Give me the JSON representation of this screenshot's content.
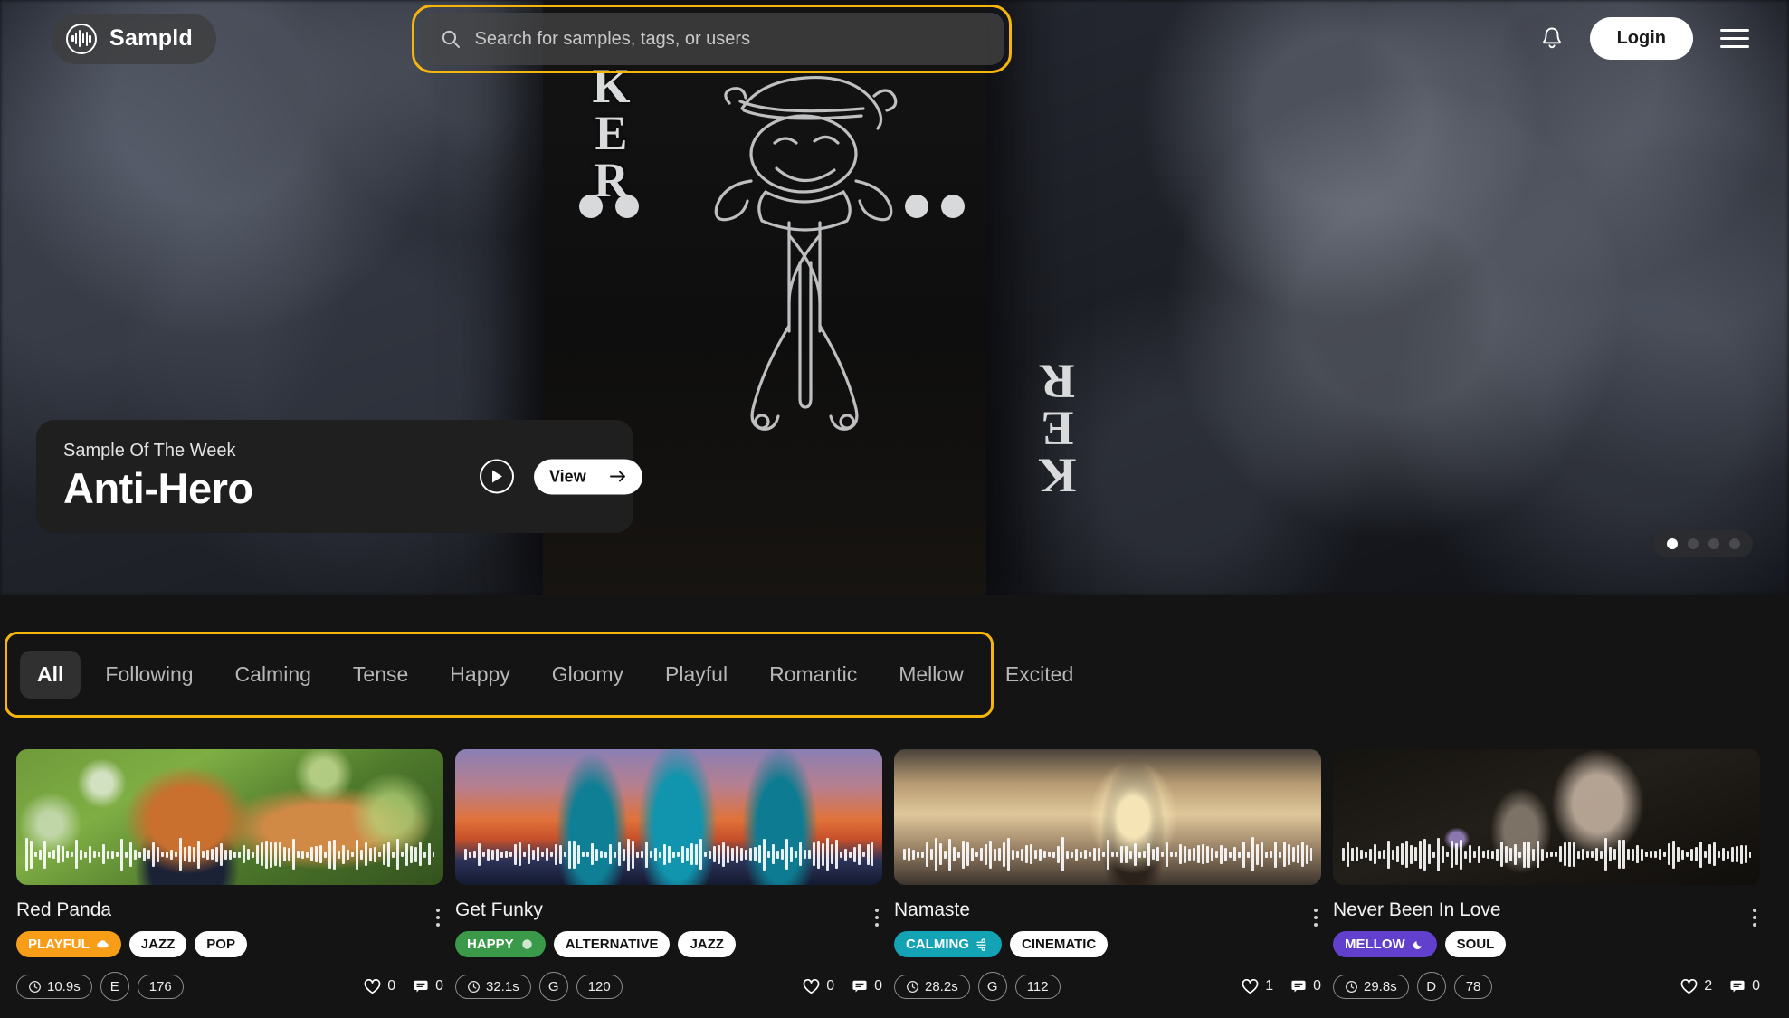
{
  "brand": {
    "name": "Sampld",
    "logo_icon": "waveform-circle-icon",
    "accent": "#f5b50a"
  },
  "header": {
    "search": {
      "placeholder": "Search for samples, tags, or users",
      "icon": "search-icon",
      "focused": true
    },
    "notifications_icon": "bell-icon",
    "login_label": "Login",
    "menu_icon": "hamburger-menu-icon"
  },
  "hero": {
    "eyebrow": "Sample Of The Week",
    "title": "Anti-Hero",
    "play_icon": "play-circle-icon",
    "view_label": "View",
    "view_arrow_icon": "arrow-right-icon",
    "carousel": {
      "count": 4,
      "active_index": 0
    },
    "background_alt": "joker-playing-card-photo"
  },
  "tabs": {
    "focused": true,
    "active": "All",
    "items": [
      {
        "label": "All",
        "active": true
      },
      {
        "label": "Following",
        "active": false
      },
      {
        "label": "Calming",
        "active": false
      },
      {
        "label": "Tense",
        "active": false
      },
      {
        "label": "Happy",
        "active": false
      },
      {
        "label": "Gloomy",
        "active": false
      },
      {
        "label": "Playful",
        "active": false
      },
      {
        "label": "Romantic",
        "active": false
      },
      {
        "label": "Mellow",
        "active": false
      },
      {
        "label": "Excited",
        "active": false
      }
    ]
  },
  "cards": [
    {
      "title": "Red Panda",
      "mood": {
        "label": "PLAYFUL",
        "color": "#f79d18",
        "icon": "cloud-icon"
      },
      "genres": [
        "JAZZ",
        "POP"
      ],
      "duration": "10.9s",
      "key": "E",
      "bpm": "176",
      "likes": "0",
      "comments": "0",
      "menu_icon": "kebab-menu-icon",
      "clock_icon": "clock-icon",
      "like_icon": "heart-icon",
      "comment_icon": "comment-icon",
      "image_alt": "red-panda-photo"
    },
    {
      "title": "Get Funky",
      "mood": {
        "label": "HAPPY",
        "color": "#3a9a4a",
        "icon": "smile-icon"
      },
      "genres": [
        "ALTERNATIVE",
        "JAZZ"
      ],
      "duration": "32.1s",
      "key": "G",
      "bpm": "120",
      "likes": "0",
      "comments": "0",
      "menu_icon": "kebab-menu-icon",
      "clock_icon": "clock-icon",
      "like_icon": "heart-icon",
      "comment_icon": "comment-icon",
      "image_alt": "band-playing-at-sunset-photo"
    },
    {
      "title": "Namaste",
      "mood": {
        "label": "CALMING",
        "color": "#13a3b5",
        "icon": "wind-icon"
      },
      "genres": [
        "CINEMATIC"
      ],
      "duration": "28.2s",
      "key": "G",
      "bpm": "112",
      "likes": "1",
      "comments": "0",
      "menu_icon": "kebab-menu-icon",
      "clock_icon": "clock-icon",
      "like_icon": "heart-icon",
      "comment_icon": "comment-icon",
      "image_alt": "yoga-meditation-sunrise-photo"
    },
    {
      "title": "Never Been In Love",
      "mood": {
        "label": "MELLOW",
        "color": "#6040cc",
        "icon": "moon-icon"
      },
      "genres": [
        "SOUL"
      ],
      "duration": "29.8s",
      "key": "D",
      "bpm": "78",
      "likes": "2",
      "comments": "0",
      "menu_icon": "kebab-menu-icon",
      "clock_icon": "clock-icon",
      "like_icon": "heart-icon",
      "comment_icon": "comment-icon",
      "image_alt": "woman-with-flower-dark-photo"
    }
  ]
}
